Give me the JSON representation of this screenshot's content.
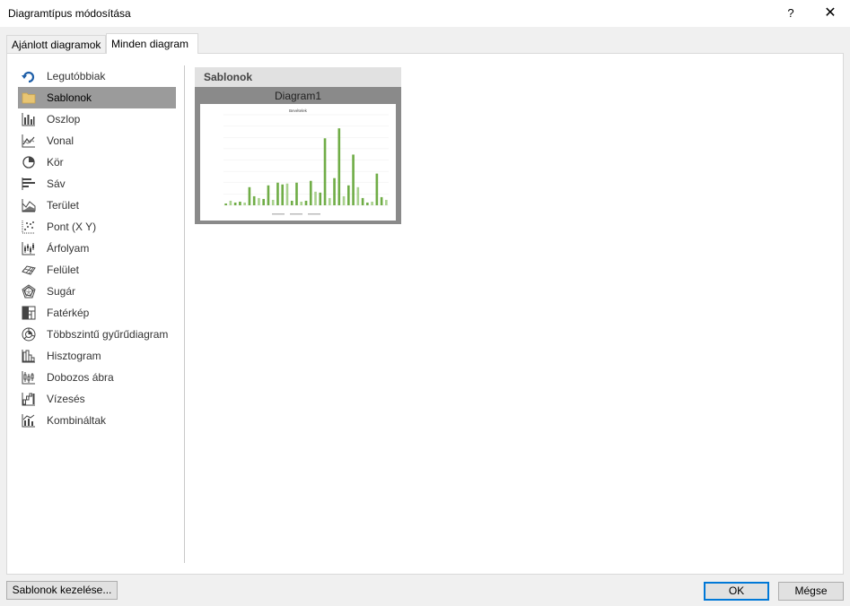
{
  "window": {
    "title": "Diagramtípus módosítása",
    "help": "?",
    "close": "✕"
  },
  "tabs": [
    {
      "label": "Ajánlott diagramok"
    },
    {
      "label": "Minden diagram"
    }
  ],
  "sidebar": {
    "items": [
      {
        "label": "Legutóbbiak",
        "icon": "recent-icon"
      },
      {
        "label": "Sablonok",
        "icon": "folder-icon",
        "selected": true
      },
      {
        "label": "Oszlop",
        "icon": "column-chart-icon"
      },
      {
        "label": "Vonal",
        "icon": "line-chart-icon"
      },
      {
        "label": "Kör",
        "icon": "pie-chart-icon"
      },
      {
        "label": "Sáv",
        "icon": "bar-chart-icon"
      },
      {
        "label": "Terület",
        "icon": "area-chart-icon"
      },
      {
        "label": "Pont (X Y)",
        "icon": "scatter-chart-icon"
      },
      {
        "label": "Árfolyam",
        "icon": "stock-chart-icon"
      },
      {
        "label": "Felület",
        "icon": "surface-chart-icon"
      },
      {
        "label": "Sugár",
        "icon": "radar-chart-icon"
      },
      {
        "label": "Fatérkép",
        "icon": "treemap-icon"
      },
      {
        "label": "Többszintű gyűrűdiagram",
        "icon": "sunburst-icon"
      },
      {
        "label": "Hisztogram",
        "icon": "histogram-icon"
      },
      {
        "label": "Dobozos ábra",
        "icon": "box-whisker-icon"
      },
      {
        "label": "Vízesés",
        "icon": "waterfall-icon"
      },
      {
        "label": "Kombináltak",
        "icon": "combo-chart-icon"
      }
    ]
  },
  "main": {
    "section_title": "Sablonok",
    "template": {
      "name": "Diagram1",
      "preview_title": "Bevételek",
      "bars": [
        0.02,
        0.05,
        0.03,
        0.04,
        0.03,
        0.2,
        0.1,
        0.08,
        0.07,
        0.22,
        0.06,
        0.25,
        0.23,
        0.24,
        0.05,
        0.25,
        0.04,
        0.05,
        0.27,
        0.15,
        0.14,
        0.74,
        0.08,
        0.3,
        0.85,
        0.1,
        0.22,
        0.56,
        0.2,
        0.08,
        0.03,
        0.04,
        0.35,
        0.09,
        0.06
      ]
    }
  },
  "footer": {
    "manage_label": "Sablonok kezelése...",
    "ok_label": "OK",
    "cancel_label": "Mégse"
  },
  "colors": {
    "accent": "#0078d7",
    "bar": "#70ad47",
    "selected": "#9b9b9b"
  }
}
